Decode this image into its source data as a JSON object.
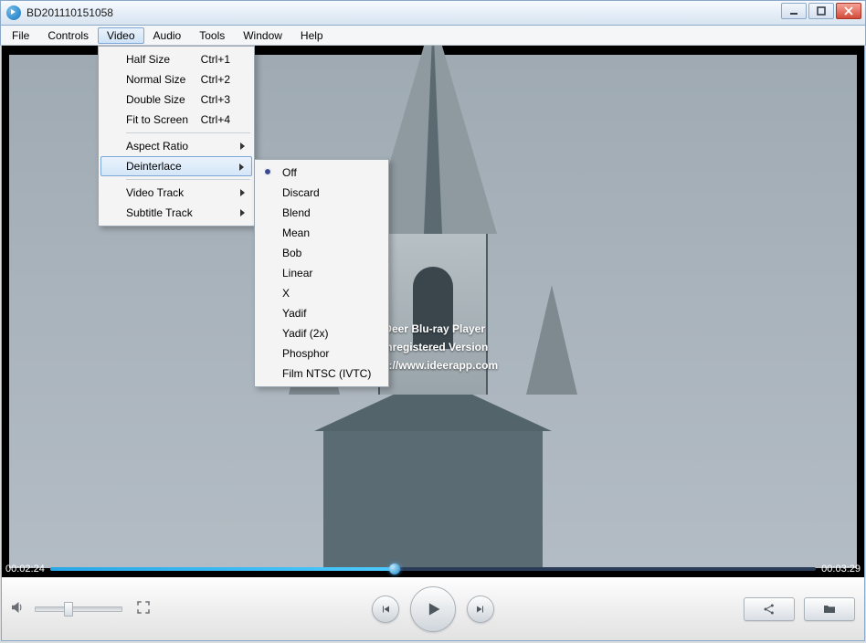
{
  "window": {
    "title": "BD201110151058"
  },
  "menubar": {
    "items": [
      "File",
      "Controls",
      "Video",
      "Audio",
      "Tools",
      "Window",
      "Help"
    ],
    "active_index": 2
  },
  "video_menu": {
    "items": [
      {
        "label": "Half Size",
        "shortcut": "Ctrl+1",
        "type": "item"
      },
      {
        "label": "Normal Size",
        "shortcut": "Ctrl+2",
        "type": "item"
      },
      {
        "label": "Double Size",
        "shortcut": "Ctrl+3",
        "type": "item"
      },
      {
        "label": "Fit to Screen",
        "shortcut": "Ctrl+4",
        "type": "item"
      },
      {
        "type": "sep"
      },
      {
        "label": "Aspect Ratio",
        "type": "submenu"
      },
      {
        "label": "Deinterlace",
        "type": "submenu",
        "hover": true
      },
      {
        "type": "sep"
      },
      {
        "label": "Video Track",
        "type": "submenu"
      },
      {
        "label": "Subtitle Track",
        "type": "submenu"
      }
    ]
  },
  "deinterlace_menu": {
    "selected_index": 0,
    "items": [
      "Off",
      "Discard",
      "Blend",
      "Mean",
      "Bob",
      "Linear",
      "X",
      "Yadif",
      "Yadif (2x)",
      "Phosphor",
      "Film NTSC (IVTC)"
    ]
  },
  "watermark": {
    "line1": "iDeer Blu-ray Player",
    "line2": "Unregistered Version",
    "line3": "http://www.ideerapp.com"
  },
  "timeline": {
    "current": "00:02:24",
    "total": "00:03:29",
    "progress_percent": 45
  },
  "volume": {
    "percent": 38
  }
}
